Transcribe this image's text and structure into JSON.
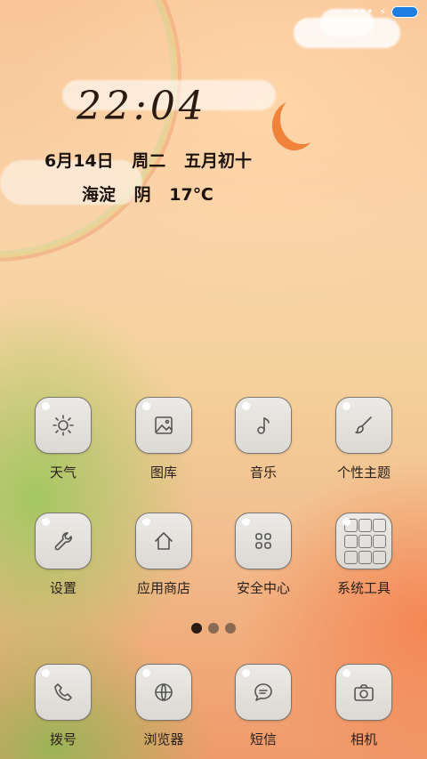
{
  "status": {
    "signal": "•••",
    "charging": "⚡"
  },
  "clock": {
    "time": "22:04"
  },
  "date": {
    "day": "6月14日",
    "weekday": "周二",
    "lunar": "五月初十"
  },
  "weather": {
    "location": "海淀",
    "condition": "阴",
    "temperature": "17℃"
  },
  "apps_row1": [
    {
      "label": "天气",
      "icon": "sun-icon"
    },
    {
      "label": "图库",
      "icon": "image-icon"
    },
    {
      "label": "音乐",
      "icon": "music-note-icon"
    },
    {
      "label": "个性主题",
      "icon": "brush-icon"
    }
  ],
  "apps_row2": [
    {
      "label": "设置",
      "icon": "wrench-icon"
    },
    {
      "label": "应用商店",
      "icon": "house-icon"
    },
    {
      "label": "安全中心",
      "icon": "grid-icon"
    },
    {
      "label": "系统工具",
      "icon": "folder-icon"
    }
  ],
  "pager": {
    "pages": 3,
    "active": 0
  },
  "dock": [
    {
      "label": "拨号",
      "icon": "phone-icon"
    },
    {
      "label": "浏览器",
      "icon": "globe-icon"
    },
    {
      "label": "短信",
      "icon": "message-icon"
    },
    {
      "label": "相机",
      "icon": "camera-icon"
    }
  ],
  "colors": {
    "battery": "#1e7de0",
    "accent": "#f0823a"
  }
}
